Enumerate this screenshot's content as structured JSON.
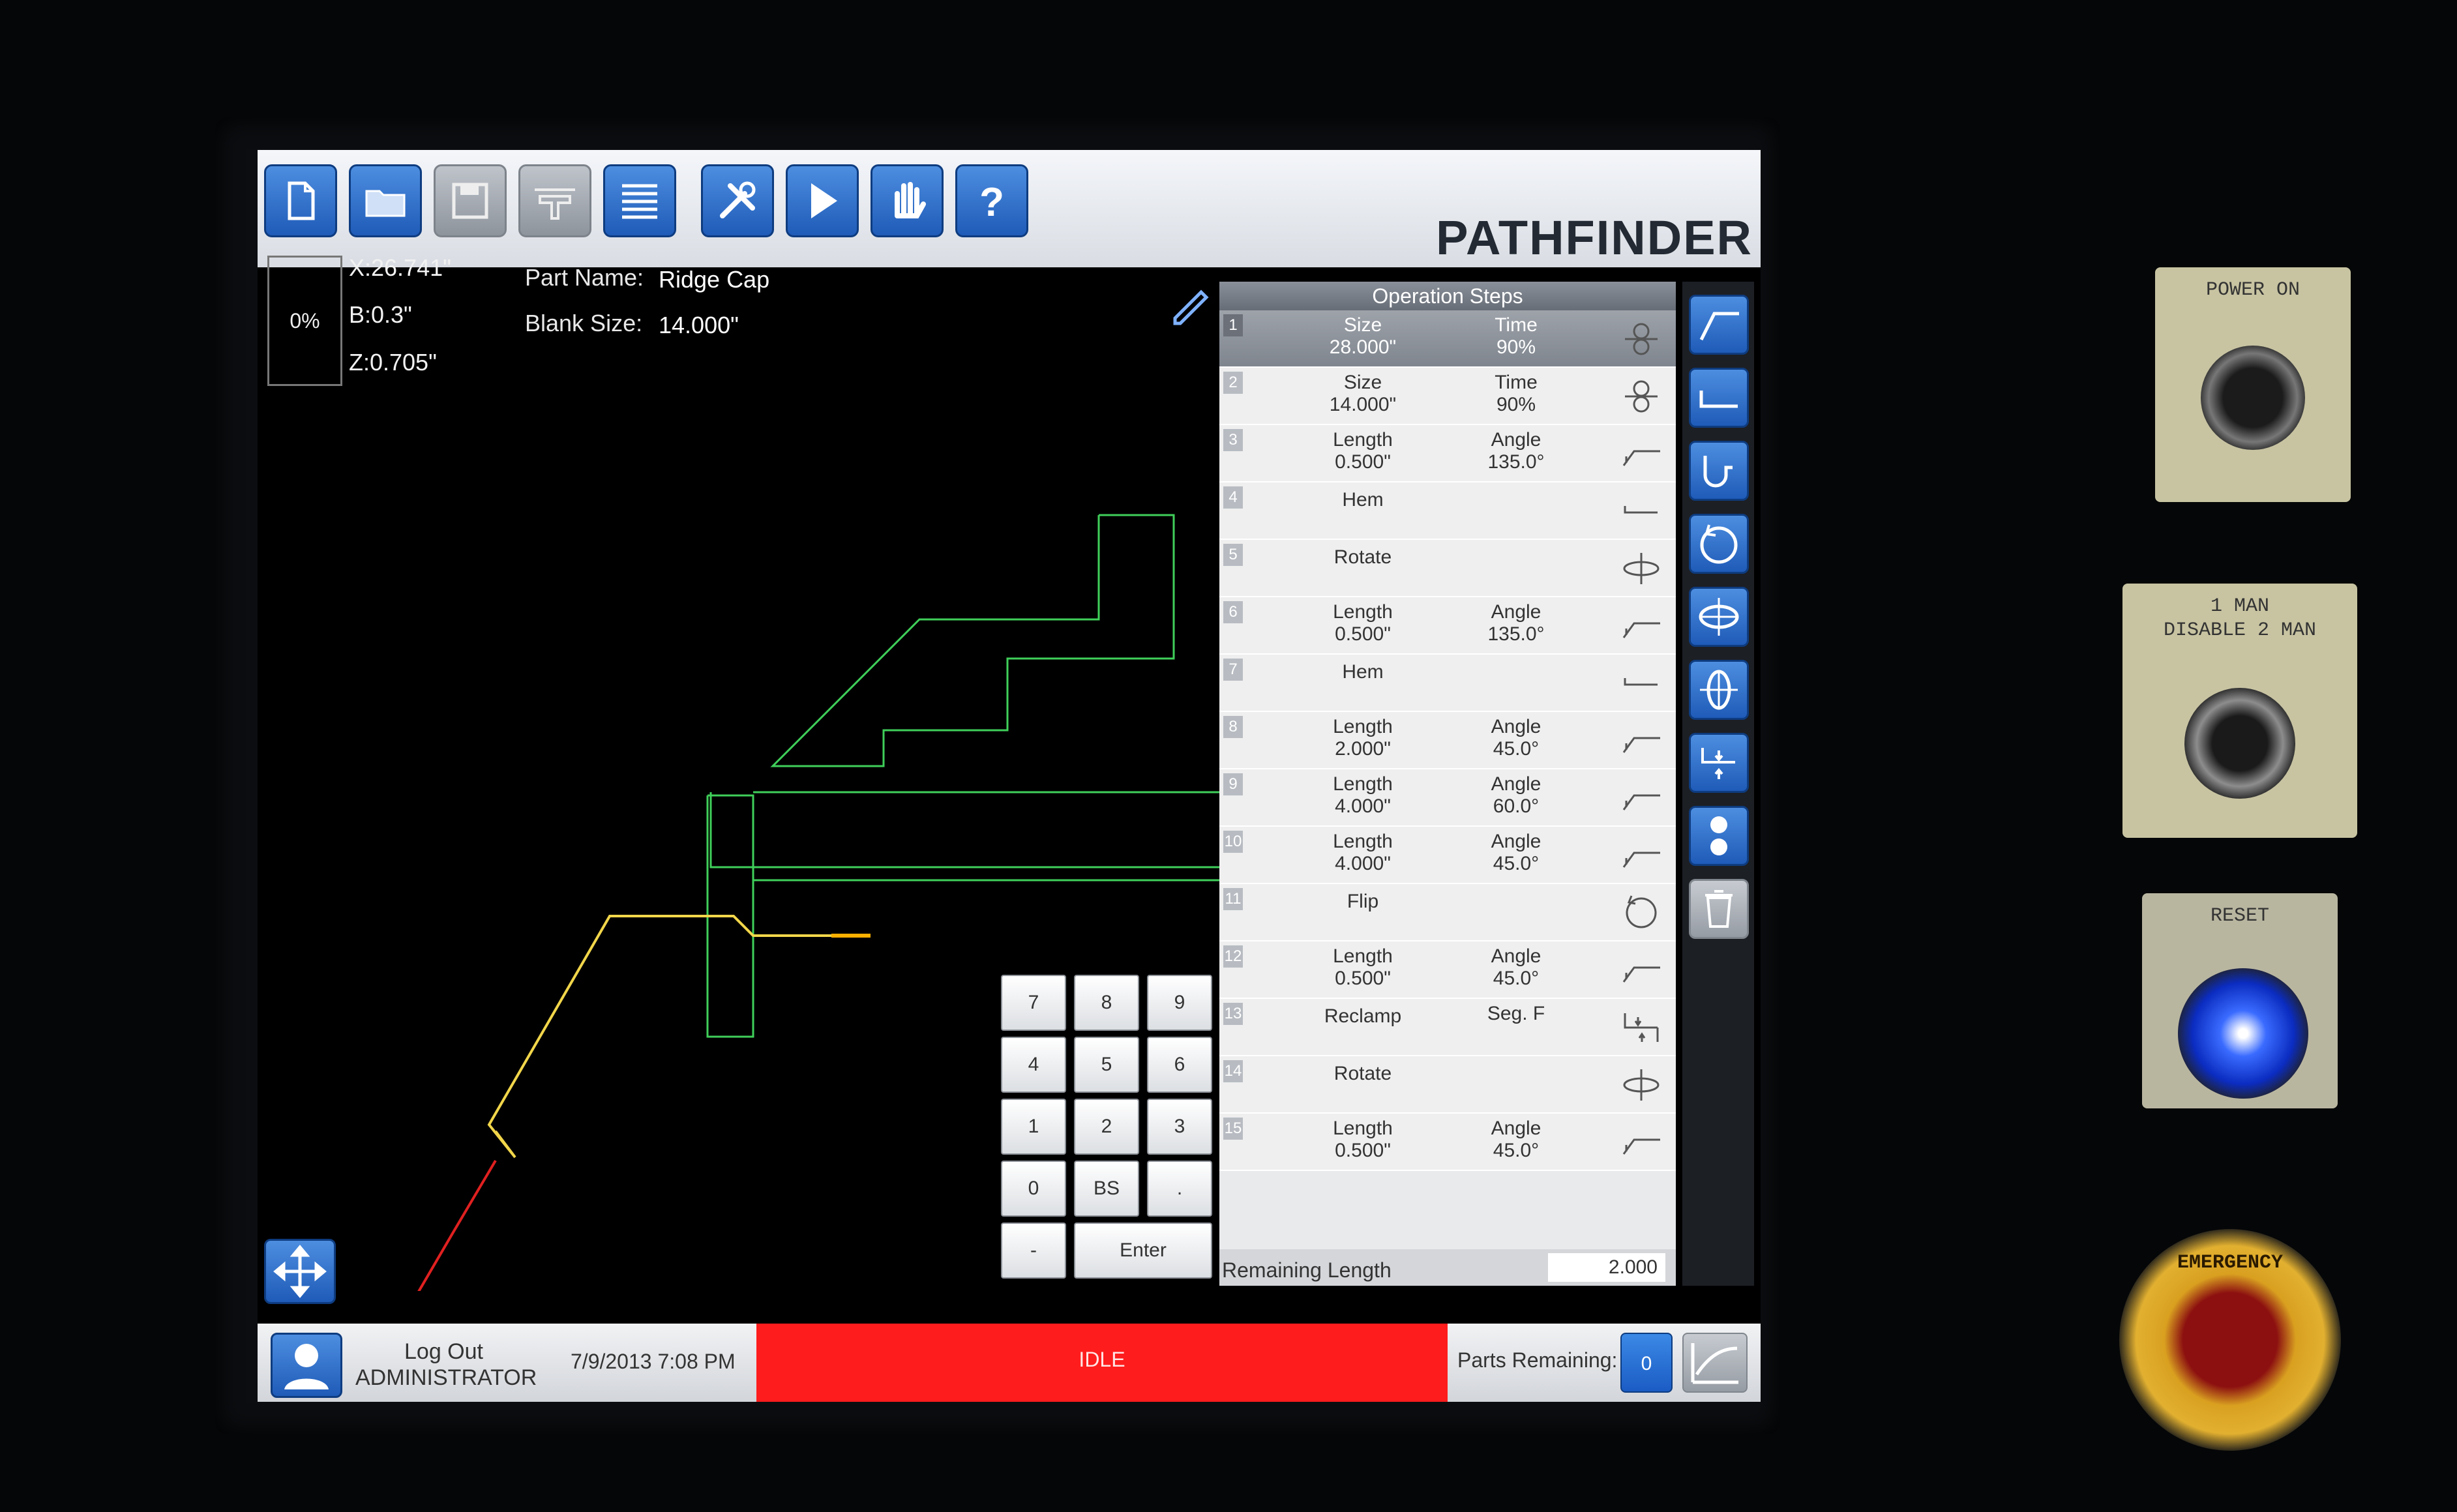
{
  "toolbar": {
    "brand": "PATHFINDER",
    "buttons": [
      {
        "name": "new-file-icon",
        "enabled": true
      },
      {
        "name": "open-folder-icon",
        "enabled": true
      },
      {
        "name": "save-icon",
        "enabled": false
      },
      {
        "name": "tooling-icon",
        "enabled": false
      },
      {
        "name": "list-icon",
        "enabled": true
      },
      {
        "name": "tools-icon",
        "enabled": true
      },
      {
        "name": "play-icon",
        "enabled": true
      },
      {
        "name": "hand-stop-icon",
        "enabled": true
      },
      {
        "name": "help-icon",
        "enabled": true
      }
    ]
  },
  "info": {
    "percent": "0%",
    "x": "X:26.741\"",
    "b": "B:0.3\"",
    "z": "Z:0.705\"",
    "part_name_label": "Part Name:",
    "part_name": "Ridge Cap",
    "blank_size_label": "Blank Size:",
    "blank_size": "14.000\""
  },
  "operation_steps": {
    "title": "Operation Steps",
    "steps": [
      {
        "num": "1",
        "left_label": "Size",
        "left_value": "28.000\"",
        "right_label": "Time",
        "right_value": "90%",
        "icon": "clamp-icon"
      },
      {
        "num": "2",
        "left_label": "Size",
        "left_value": "14.000\"",
        "right_label": "Time",
        "right_value": "90%",
        "icon": "clamp-icon"
      },
      {
        "num": "3",
        "left_label": "Length",
        "left_value": "0.500\"",
        "right_label": "Angle",
        "right_value": "135.0°",
        "icon": "bend-icon"
      },
      {
        "num": "4",
        "left_label": "Hem",
        "left_value": "",
        "right_label": "",
        "right_value": "",
        "icon": "hem-icon"
      },
      {
        "num": "5",
        "left_label": "Rotate",
        "left_value": "",
        "right_label": "",
        "right_value": "",
        "icon": "rotate-icon"
      },
      {
        "num": "6",
        "left_label": "Length",
        "left_value": "0.500\"",
        "right_label": "Angle",
        "right_value": "135.0°",
        "icon": "bend-icon"
      },
      {
        "num": "7",
        "left_label": "Hem",
        "left_value": "",
        "right_label": "",
        "right_value": "",
        "icon": "hem-icon"
      },
      {
        "num": "8",
        "left_label": "Length",
        "left_value": "2.000\"",
        "right_label": "Angle",
        "right_value": "45.0°",
        "icon": "bend-icon"
      },
      {
        "num": "9",
        "left_label": "Length",
        "left_value": "4.000\"",
        "right_label": "Angle",
        "right_value": "60.0°",
        "icon": "bend-icon"
      },
      {
        "num": "10",
        "left_label": "Length",
        "left_value": "4.000\"",
        "right_label": "Angle",
        "right_value": "45.0°",
        "icon": "bend-icon"
      },
      {
        "num": "11",
        "left_label": "Flip",
        "left_value": "",
        "right_label": "",
        "right_value": "",
        "icon": "flip-icon"
      },
      {
        "num": "12",
        "left_label": "Length",
        "left_value": "0.500\"",
        "right_label": "Angle",
        "right_value": "45.0°",
        "icon": "bend-icon"
      },
      {
        "num": "13",
        "left_label": "Reclamp",
        "left_value": "",
        "right_label": "Seg. F",
        "right_value": "",
        "icon": "reclamp-icon"
      },
      {
        "num": "14",
        "left_label": "Rotate",
        "left_value": "",
        "right_label": "",
        "right_value": "",
        "icon": "rotate-icon"
      },
      {
        "num": "15",
        "left_label": "Length",
        "left_value": "0.500\"",
        "right_label": "Angle",
        "right_value": "45.0°",
        "icon": "bend-icon"
      }
    ],
    "remaining_length_label": "Remaining Length",
    "remaining_length_value": "2.000"
  },
  "side_buttons": [
    {
      "name": "bend-up-icon",
      "enabled": true
    },
    {
      "name": "bend-flat-icon",
      "enabled": true
    },
    {
      "name": "hem-tool-icon",
      "enabled": true
    },
    {
      "name": "flip-tool-icon",
      "enabled": true
    },
    {
      "name": "rotate-horizontal-icon",
      "enabled": true
    },
    {
      "name": "rotate-vertical-icon",
      "enabled": true
    },
    {
      "name": "reclamp-tool-icon",
      "enabled": true
    },
    {
      "name": "clamp-tool-icon",
      "enabled": true
    },
    {
      "name": "trash-icon",
      "enabled": false
    }
  ],
  "keypad": {
    "keys": [
      "7",
      "8",
      "9",
      "4",
      "5",
      "6",
      "1",
      "2",
      "3",
      "0",
      "BS",
      ".",
      "-",
      "Enter"
    ]
  },
  "status_bar": {
    "logout": "Log Out",
    "user": "ADMINISTRATOR",
    "datetime": "7/9/2013 7:08 PM",
    "state": "IDLE",
    "parts_remaining_label": "Parts Remaining:",
    "parts_remaining_value": "0"
  },
  "physical_controls": {
    "power_label": "POWER ON",
    "man_label_1": "1 MAN",
    "man_label_2": "DISABLE 2 MAN",
    "reset_label": "RESET",
    "emergency_label": "EMERGENCY"
  },
  "colors": {
    "accent_blue": "#2b6fd0",
    "idle_red": "#ff1c1c",
    "profile_green": "#3fcf5a",
    "profile_yellow": "#f2d64a",
    "profile_red": "#e02020"
  }
}
